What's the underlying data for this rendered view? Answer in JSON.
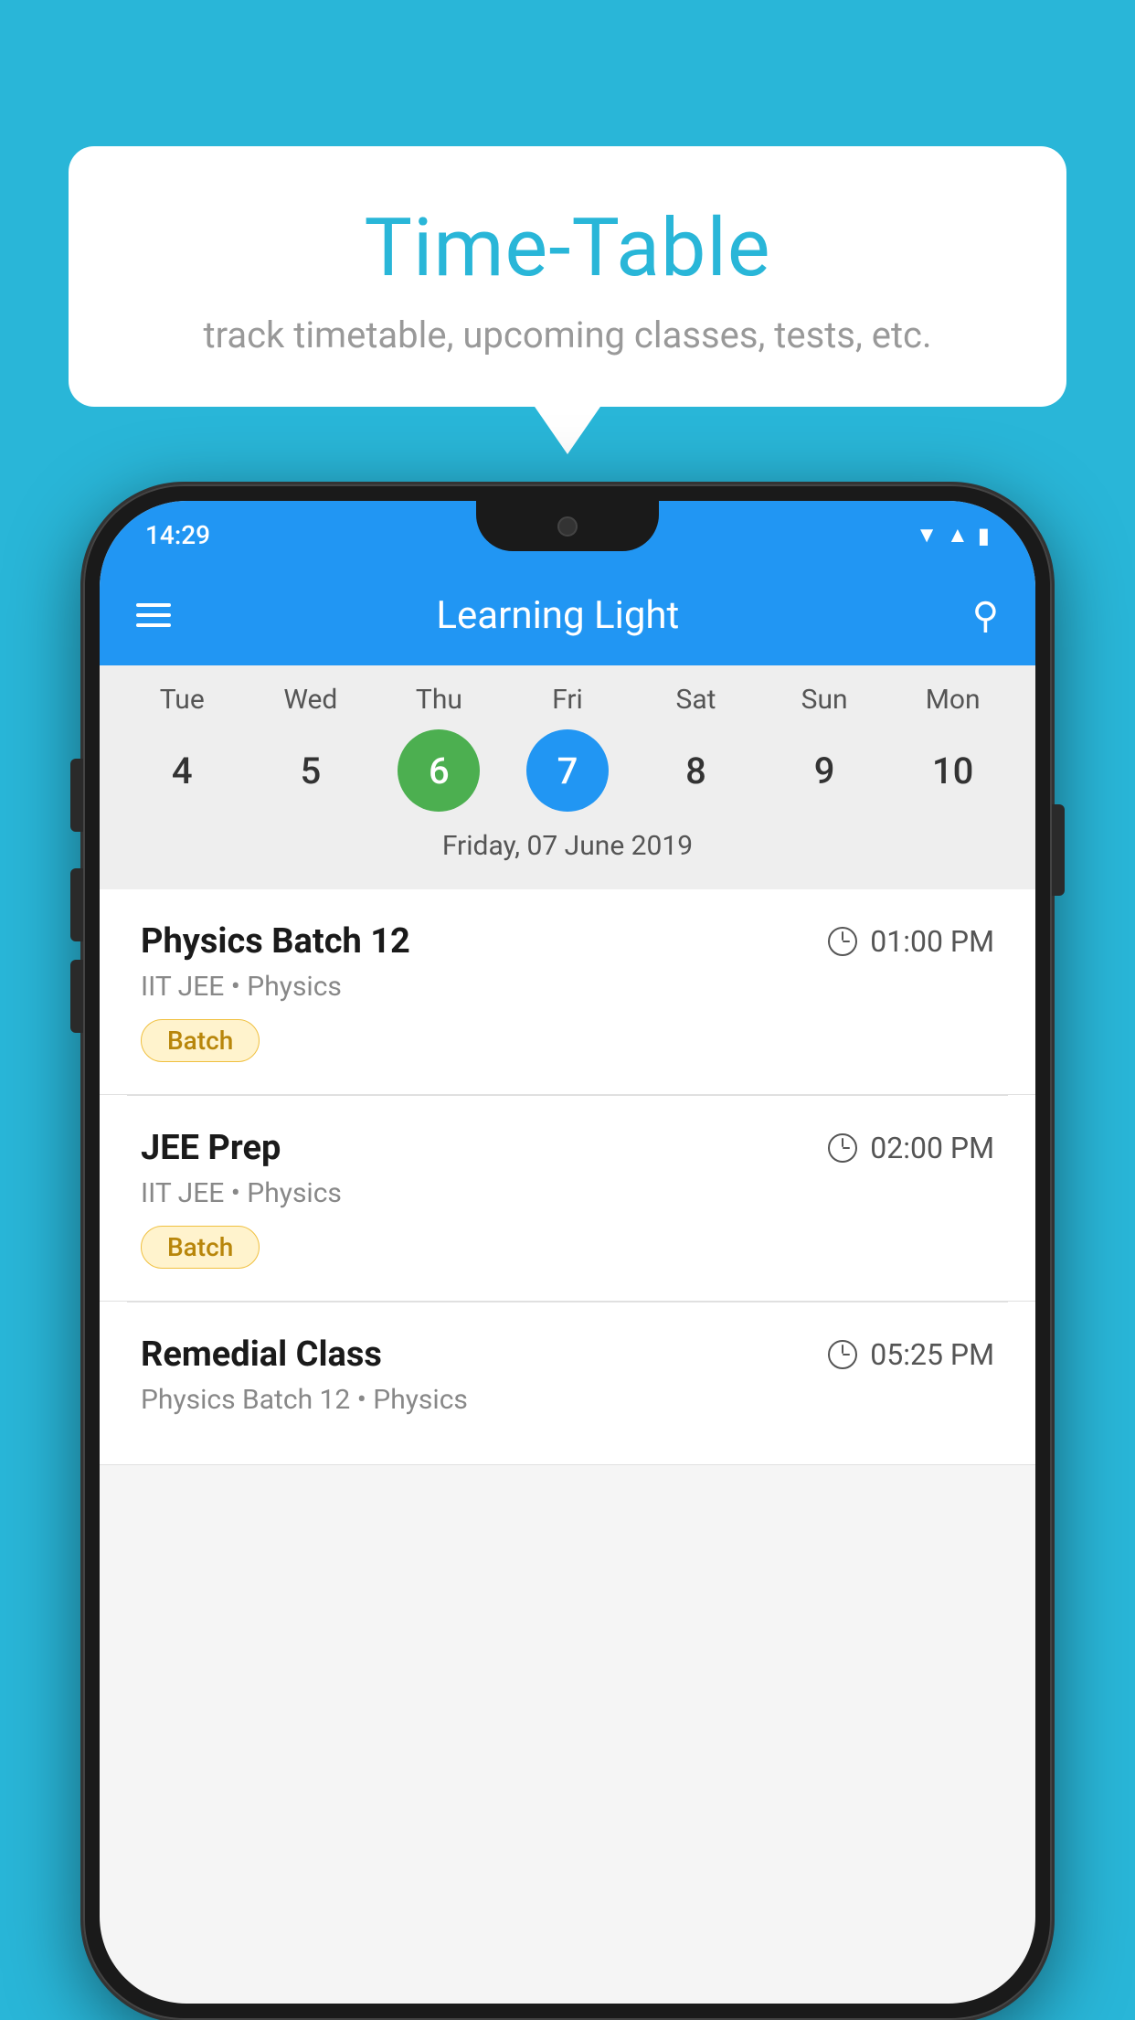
{
  "background": {
    "color": "#29B6D8"
  },
  "speech_bubble": {
    "title": "Time-Table",
    "subtitle": "track timetable, upcoming classes, tests, etc."
  },
  "phone": {
    "status_bar": {
      "time": "14:29"
    },
    "app_bar": {
      "title": "Learning Light"
    },
    "calendar": {
      "days_of_week": [
        "Tue",
        "Wed",
        "Thu",
        "Fri",
        "Sat",
        "Sun",
        "Mon"
      ],
      "dates": [
        "4",
        "5",
        "6",
        "7",
        "8",
        "9",
        "10"
      ],
      "today_index": 2,
      "selected_index": 3,
      "selected_date_label": "Friday, 07 June 2019"
    },
    "schedule": [
      {
        "title": "Physics Batch 12",
        "time": "01:00 PM",
        "meta": "IIT JEE • Physics",
        "badge": "Batch"
      },
      {
        "title": "JEE Prep",
        "time": "02:00 PM",
        "meta": "IIT JEE • Physics",
        "badge": "Batch"
      },
      {
        "title": "Remedial Class",
        "time": "05:25 PM",
        "meta": "Physics Batch 12 • Physics",
        "badge": ""
      }
    ]
  }
}
